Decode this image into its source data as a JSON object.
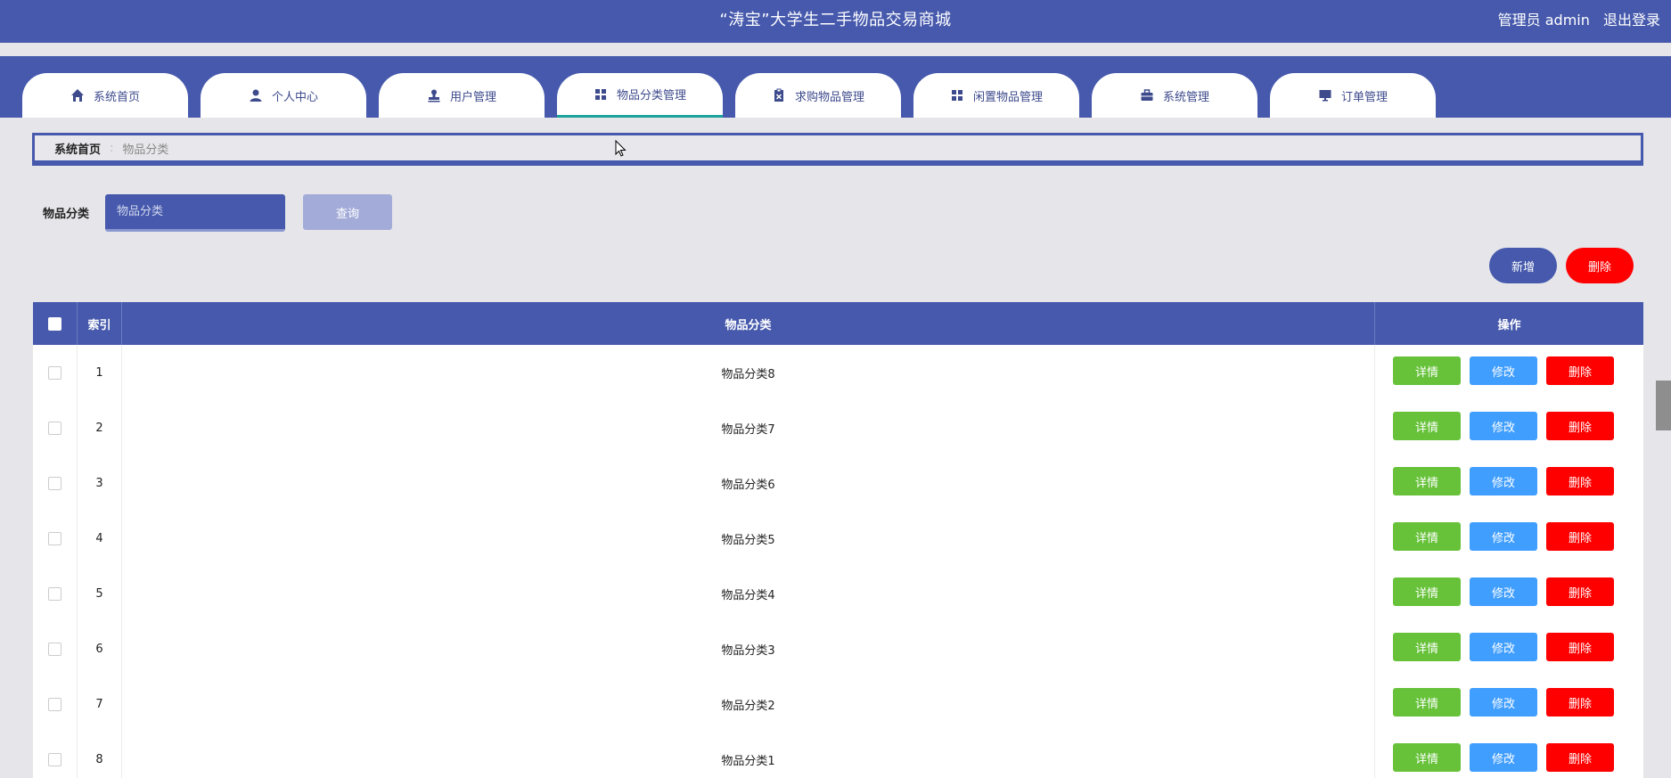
{
  "header": {
    "title": "“涛宝”大学生二手物品交易商城",
    "user_role": "管理员 admin",
    "logout": "退出登录"
  },
  "nav": {
    "tabs": [
      {
        "label": "系统首页",
        "icon": "home-icon"
      },
      {
        "label": "个人中心",
        "icon": "person-icon"
      },
      {
        "label": "用户管理",
        "icon": "user-stamp-icon"
      },
      {
        "label": "物品分类管理",
        "icon": "grid-icon"
      },
      {
        "label": "求购物品管理",
        "icon": "clipboard-icon"
      },
      {
        "label": "闲置物品管理",
        "icon": "grid-icon"
      },
      {
        "label": "系统管理",
        "icon": "briefcase-icon"
      },
      {
        "label": "订单管理",
        "icon": "monitor-icon"
      }
    ],
    "active_index": 3
  },
  "breadcrumb": {
    "home": "系统首页",
    "separator": ":",
    "current": "物品分类"
  },
  "search": {
    "label": "物品分类",
    "placeholder": "物品分类",
    "button": "查询"
  },
  "actions": {
    "add": "新增",
    "delete": "删除"
  },
  "table": {
    "headers": {
      "index": "索引",
      "category": "物品分类",
      "ops": "操作"
    },
    "row_buttons": {
      "detail": "详情",
      "edit": "修改",
      "remove": "删除"
    },
    "rows": [
      {
        "index": "1",
        "category": "物品分类8"
      },
      {
        "index": "2",
        "category": "物品分类7"
      },
      {
        "index": "3",
        "category": "物品分类6"
      },
      {
        "index": "4",
        "category": "物品分类5"
      },
      {
        "index": "5",
        "category": "物品分类4"
      },
      {
        "index": "6",
        "category": "物品分类3"
      },
      {
        "index": "7",
        "category": "物品分类2"
      },
      {
        "index": "8",
        "category": "物品分类1"
      }
    ]
  },
  "colors": {
    "primary": "#4659ac",
    "detail": "#67c23a",
    "edit": "#409eff",
    "danger": "#ff0000",
    "active_underline": "#1aa39b"
  }
}
